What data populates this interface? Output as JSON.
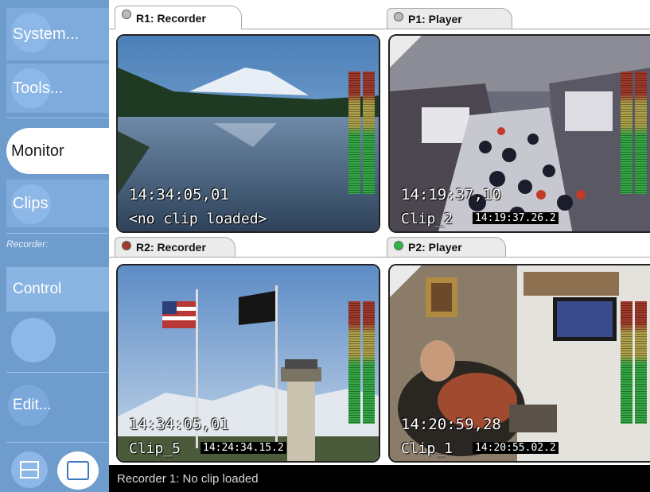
{
  "sidebar": {
    "system": "System...",
    "tools": "Tools...",
    "monitor": "Monitor",
    "clips": "Clips",
    "section_label": "Recorder:",
    "control": "Control",
    "edit": "Edit..."
  },
  "panes": [
    {
      "tab": "R1: Recorder",
      "led_color": "#b9b9b9",
      "timecode": "14:34:05,01",
      "clip": "<no clip loaded>",
      "burn_in": ""
    },
    {
      "tab": "P1: Player",
      "led_color": "#b9b9b9",
      "timecode": "14:19:37,10",
      "clip": "Clip_2",
      "burn_in": "14:19:37.26.2"
    },
    {
      "tab": "R2: Recorder",
      "led_color": "#a33a2a",
      "timecode": "14:34:05,01",
      "clip": "Clip_5",
      "burn_in": "14:24:34.15.2"
    },
    {
      "tab": "P2: Player",
      "led_color": "#2fb54a",
      "timecode": "14:20:59,28",
      "clip": "Clip_1",
      "burn_in": "14:20:55.02.2"
    }
  ],
  "status": {
    "text": "Recorder 1: No clip loaded"
  }
}
